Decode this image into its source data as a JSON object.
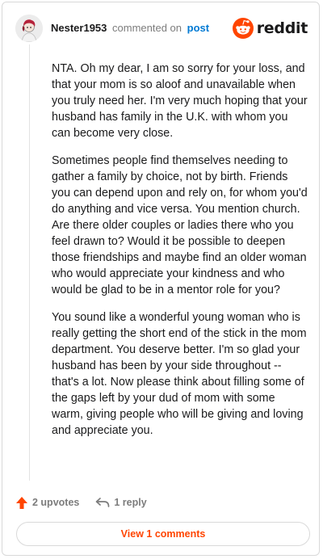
{
  "comment": {
    "username": "Nester1953",
    "action_text": "commented on",
    "post_link": "post",
    "paragraphs": [
      "NTA. Oh my dear, I am so sorry for your loss, and that your mom is so aloof and unavailable when you truly need her. I'm very much hoping that your husband has family in the U.K. with whom you can become very close.",
      "Sometimes people find themselves needing to gather a family by choice, not by birth. Friends you can depend upon and rely on, for whom you'd do anything and vice versa. You mention church. Are there older couples or ladies there who you feel drawn to? Would it be possible to deepen those friendships and maybe find an older woman who would appreciate your kindness and who would be glad to be in a mentor role for you?",
      "You sound like a wonderful young woman who is really getting the short end of the stick in the mom department. You deserve better. I'm so glad your husband has been by your side throughout -- that's a lot. Now please think about filling some of the gaps left by your dud of mom with some warm, giving people who will be giving and loving and appreciate you."
    ]
  },
  "brand": {
    "wordmark": "reddit",
    "color": "#ff4500"
  },
  "actions": {
    "upvotes_label": "2 upvotes",
    "reply_label": "1 reply"
  },
  "footer": {
    "view_comments_label": "View 1 comments"
  },
  "icons": {
    "avatar": "avatar",
    "brand_logo": "reddit-logo-icon",
    "upvote": "upvote-arrow-icon",
    "reply": "reply-arrow-icon"
  },
  "colors": {
    "accent": "#ff4500",
    "link": "#0079d3",
    "muted": "#7c7c7c"
  }
}
